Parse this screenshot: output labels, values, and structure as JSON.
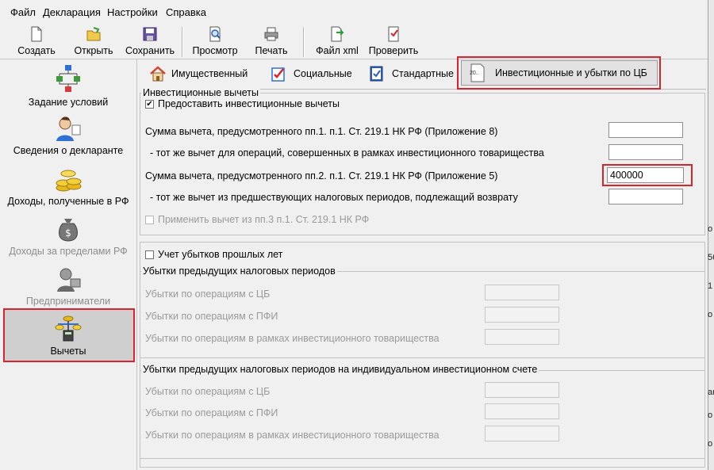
{
  "menu": [
    "Файл",
    "Декларация",
    "Настройки",
    "Справка"
  ],
  "toolbar": {
    "create": "Создать",
    "open": "Открыть",
    "save": "Сохранить",
    "preview": "Просмотр",
    "print": "Печать",
    "xml": "Файл xml",
    "check": "Проверить"
  },
  "sidebar": {
    "conditions": "Задание условий",
    "declarant": "Сведения о декларанте",
    "income_rf": "Доходы, полученные в РФ",
    "income_abroad": "Доходы за пределами РФ",
    "entrepreneurs": "Предприниматели",
    "deductions": "Вычеты"
  },
  "tabs": {
    "property": "Имущественный",
    "social": "Социальные",
    "standard": "Стандартные",
    "investment": "Инвестиционные и убытки по ЦБ",
    "investment_icon_text": "20.."
  },
  "investment_group": {
    "title": "Инвестиционные вычеты",
    "provide_checkbox": "Предоставить инвестиционные вычеты",
    "provide_checked": "✔",
    "row1": "Сумма вычета, предусмотренного пп.1. п.1. Ст. 219.1 НК РФ (Приложение 8)",
    "row2": "- тот же вычет для операций, совершенных в рамках инвестиционного товарищества",
    "row3": "Сумма вычета, предусмотренного пп.2. п.1. Ст. 219.1 НК РФ (Приложение 5)",
    "row3_value": "400000",
    "row4": "- тот же вычет из предшествующих налоговых периодов, подлежащий возврату",
    "apply_pp3": "Применить вычет из пп.3 п.1. Ст. 219.1 НК РФ"
  },
  "losses": {
    "checkbox": "Учет убытков прошлых лет",
    "group1_title": "Убытки предыдущих налоговых периодов",
    "group2_title": "Убытки предыдущих налоговых периодов на индивидуальном инвестиционном счете",
    "cb": "Убытки по операциям с ЦБ",
    "pfi": "Убытки по операциям с ПФИ",
    "partnership": "Убытки по операциям в рамках инвестиционного товарищества"
  },
  "edge_glyphs": [
    "о",
    "56",
    "1",
    "о",
    "ан",
    "о",
    "о"
  ],
  "colors": {
    "highlight": "#d9232d",
    "selected_bg": "#cfcfcf"
  }
}
